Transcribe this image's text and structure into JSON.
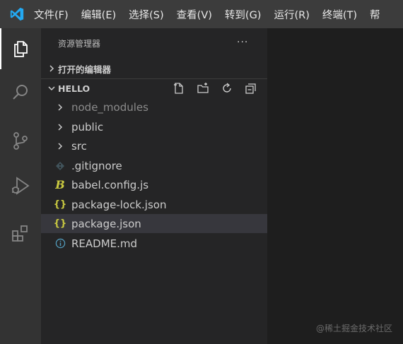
{
  "menubar": {
    "app_icon": "vscode-logo-icon",
    "items": [
      "文件(F)",
      "编辑(E)",
      "选择(S)",
      "查看(V)",
      "转到(G)",
      "运行(R)",
      "终端(T)",
      "帮"
    ]
  },
  "activitybar": {
    "icons": [
      "explorer-icon",
      "search-icon",
      "source-control-icon",
      "run-debug-icon",
      "extensions-icon"
    ],
    "active": "explorer-icon"
  },
  "sidebar": {
    "title": "资源管理器",
    "more": "···",
    "open_editors_label": "打开的编辑器",
    "folder_label": "HELLO",
    "folder_actions": [
      "new-file-icon",
      "new-folder-icon",
      "refresh-icon",
      "collapse-all-icon"
    ],
    "items": [
      {
        "name": "node_modules",
        "type": "folder",
        "icon": "chevron-right-icon"
      },
      {
        "name": "public",
        "type": "folder",
        "icon": "chevron-right-icon"
      },
      {
        "name": "src",
        "type": "folder",
        "icon": "chevron-right-icon"
      },
      {
        "name": ".gitignore",
        "type": "file",
        "icon": "git-diamond-icon"
      },
      {
        "name": "babel.config.js",
        "type": "file",
        "icon": "babel-icon"
      },
      {
        "name": "package-lock.json",
        "type": "file",
        "icon": "json-braces-icon"
      },
      {
        "name": "package.json",
        "type": "file",
        "icon": "json-braces-icon",
        "selected": true
      },
      {
        "name": "README.md",
        "type": "file",
        "icon": "info-icon"
      }
    ]
  },
  "watermark": "@稀土掘金技术社区",
  "colors": {
    "accent": "#007acc",
    "json": "#cbcb41",
    "babel": "#cbcb41",
    "info": "#519aba"
  }
}
